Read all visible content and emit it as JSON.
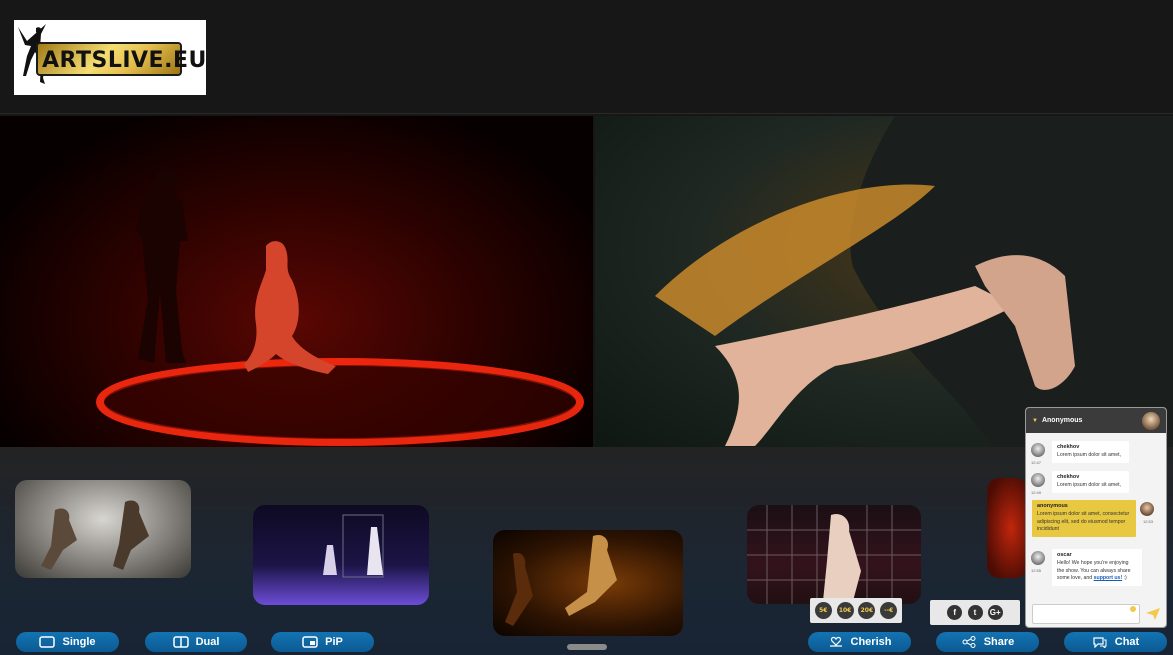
{
  "brand": {
    "logo_text": "ARTSLIVE.EU"
  },
  "view_modes": [
    {
      "label": "Single",
      "icon": "single-view-icon"
    },
    {
      "label": "Dual",
      "icon": "dual-view-icon"
    },
    {
      "label": "PiP",
      "icon": "pip-view-icon"
    }
  ],
  "actions": {
    "cherish": "Cherish",
    "share": "Share",
    "chat": "Chat"
  },
  "donations": [
    "5€",
    "10€",
    "20€",
    "--€"
  ],
  "social": [
    {
      "label": "f",
      "icon": "facebook-icon"
    },
    {
      "label": "t",
      "icon": "twitter-icon"
    },
    {
      "label": "G+",
      "icon": "google-plus-icon"
    }
  ],
  "chat": {
    "user": "Anonymous",
    "messages": [
      {
        "author": "chekhov",
        "text": "Lorem ipsum dolor sit amet,",
        "time": "12:47"
      },
      {
        "author": "chekhov",
        "text": "Lorem ipsum dolor sit amet,",
        "time": "12:49"
      },
      {
        "author": "anonymous",
        "text": "Lorem ipsum dolor sit amet, consectetur adipiscing elit, sed do eiusmod tempor incididunt",
        "time": "12:53",
        "own": true
      },
      {
        "author": "oscar",
        "text": "Hello! We hope you're enjoying the show. You can always share some love, and",
        "link": "support us!",
        "suffix": " :)",
        "time": "12:55"
      }
    ]
  },
  "colors": {
    "button_blue": "#0c5a92",
    "own_bubble": "#e8c840",
    "background": "#161616"
  }
}
